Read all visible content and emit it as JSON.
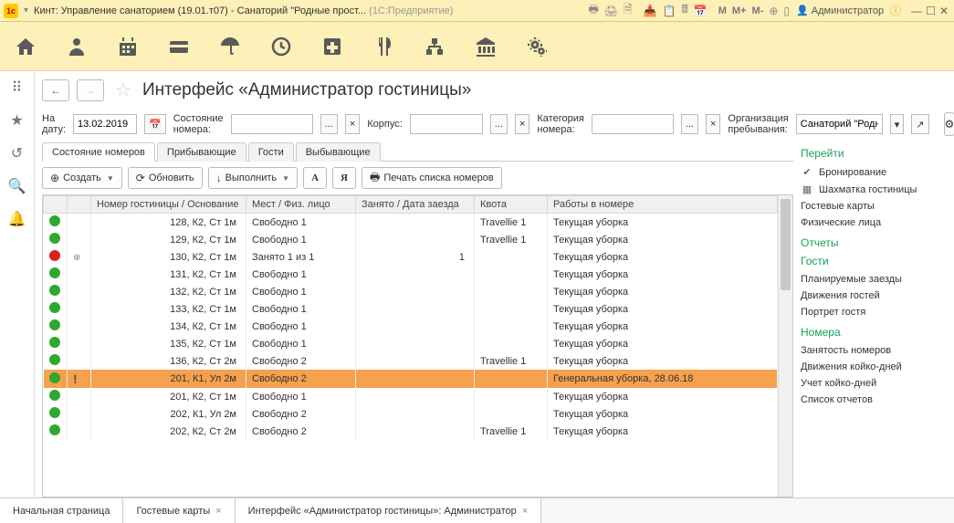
{
  "titlebar": {
    "app_title": "Кинт: Управление санаторием (19.01.т07) - Санаторий \"Родные прост...",
    "platform": "(1С:Предприятие)",
    "m_labels": [
      "M",
      "M+",
      "M-"
    ],
    "user_label": "Администратор"
  },
  "page": {
    "title": "Интерфейс «Администратор гостиницы»"
  },
  "filters": {
    "date_label": "На дату:",
    "date_value": "13.02.2019",
    "status_label": "Состояние номера:",
    "status_value": "",
    "building_label": "Корпус:",
    "building_value": "",
    "category_label": "Категория номера:",
    "category_value": "",
    "org_label": "Организация пребывания:",
    "org_value": "Санаторий \"Родн",
    "small_dots": "...",
    "small_x": "×"
  },
  "tabs": {
    "items": [
      "Состояние номеров",
      "Прибывающие",
      "Гости",
      "Выбывающие"
    ],
    "active": 0
  },
  "tblbar": {
    "create": "Создать",
    "refresh": "Обновить",
    "run": "Выполнить",
    "letter_a": "А",
    "letter_ya": "Я",
    "print": "Печать списка номеров"
  },
  "columns": [
    "",
    "",
    "Номер гостиницы / Основание",
    "Мест / Физ. лицо",
    "Занято / Дата заезда",
    "Квота",
    "Работы в номере"
  ],
  "rows": [
    {
      "status": "green",
      "mark": "",
      "room": "128, К2, Ст 1м",
      "beds": "Свободно 1",
      "busy": "",
      "quota": "Travellie 1",
      "work": "Текущая уборка",
      "hl": false
    },
    {
      "status": "green",
      "mark": "",
      "room": "129, К2, Ст 1м",
      "beds": "Свободно 1",
      "busy": "",
      "quota": "Travellie 1",
      "work": "Текущая уборка",
      "hl": false
    },
    {
      "status": "red",
      "mark": "+",
      "room": "130, К2, Ст 1м",
      "beds": "Занято 1 из 1",
      "busy": "1",
      "quota": "",
      "work": "Текущая уборка",
      "hl": false
    },
    {
      "status": "green",
      "mark": "",
      "room": "131, К2, Ст 1м",
      "beds": "Свободно 1",
      "busy": "",
      "quota": "",
      "work": "Текущая уборка",
      "hl": false
    },
    {
      "status": "green",
      "mark": "",
      "room": "132, К2, Ст 1м",
      "beds": "Свободно 1",
      "busy": "",
      "quota": "",
      "work": "Текущая уборка",
      "hl": false
    },
    {
      "status": "green",
      "mark": "",
      "room": "133, К2, Ст 1м",
      "beds": "Свободно 1",
      "busy": "",
      "quota": "",
      "work": "Текущая уборка",
      "hl": false
    },
    {
      "status": "green",
      "mark": "",
      "room": "134, К2, Ст 1м",
      "beds": "Свободно 1",
      "busy": "",
      "quota": "",
      "work": "Текущая уборка",
      "hl": false
    },
    {
      "status": "green",
      "mark": "",
      "room": "135, К2, Ст 1м",
      "beds": "Свободно 1",
      "busy": "",
      "quota": "",
      "work": "Текущая уборка",
      "hl": false
    },
    {
      "status": "green",
      "mark": "",
      "room": "136, К2, Ст 2м",
      "beds": "Свободно 2",
      "busy": "",
      "quota": "Travellie 1",
      "work": "Текущая уборка",
      "hl": false
    },
    {
      "status": "green",
      "mark": "!",
      "room": "201, К1, Ул 2м",
      "beds": "Свободно 2",
      "busy": "",
      "quota": "",
      "work": "Генеральная уборка, 28.06.18",
      "hl": true
    },
    {
      "status": "green",
      "mark": "",
      "room": "201, К2, Ст 1м",
      "beds": "Свободно 1",
      "busy": "",
      "quota": "",
      "work": "Текущая уборка",
      "hl": false
    },
    {
      "status": "green",
      "mark": "",
      "room": "202, К1, Ул 2м",
      "beds": "Свободно 2",
      "busy": "",
      "quota": "",
      "work": "Текущая уборка",
      "hl": false
    },
    {
      "status": "green",
      "mark": "",
      "room": "202, К2, Ст 2м",
      "beds": "Свободно 2",
      "busy": "",
      "quota": "Travellie 1",
      "work": "Текущая уборка",
      "hl": false
    }
  ],
  "rightnav": {
    "sec1": "Перейти",
    "items1": [
      {
        "icon": "✔",
        "label": "Бронирование"
      },
      {
        "icon": "▦",
        "label": "Шахматка гостиницы"
      },
      {
        "icon": "",
        "label": "Гостевые карты"
      },
      {
        "icon": "",
        "label": "Физические лица"
      }
    ],
    "sec2": "Отчеты",
    "sec3": "Гости",
    "items3": [
      {
        "label": "Планируемые заезды"
      },
      {
        "label": "Движения гостей"
      },
      {
        "label": "Портрет гостя"
      }
    ],
    "sec4": "Номера",
    "items4": [
      {
        "label": "Занятость номеров"
      },
      {
        "label": "Движения койко-дней"
      },
      {
        "label": "Учет койко-дней"
      },
      {
        "label": "Список отчетов"
      }
    ]
  },
  "bottomtabs": {
    "items": [
      {
        "label": "Начальная страница",
        "close": false
      },
      {
        "label": "Гостевые карты",
        "close": true
      },
      {
        "label": "Интерфейс «Администратор гостиницы»: Администратор",
        "close": true
      }
    ]
  }
}
